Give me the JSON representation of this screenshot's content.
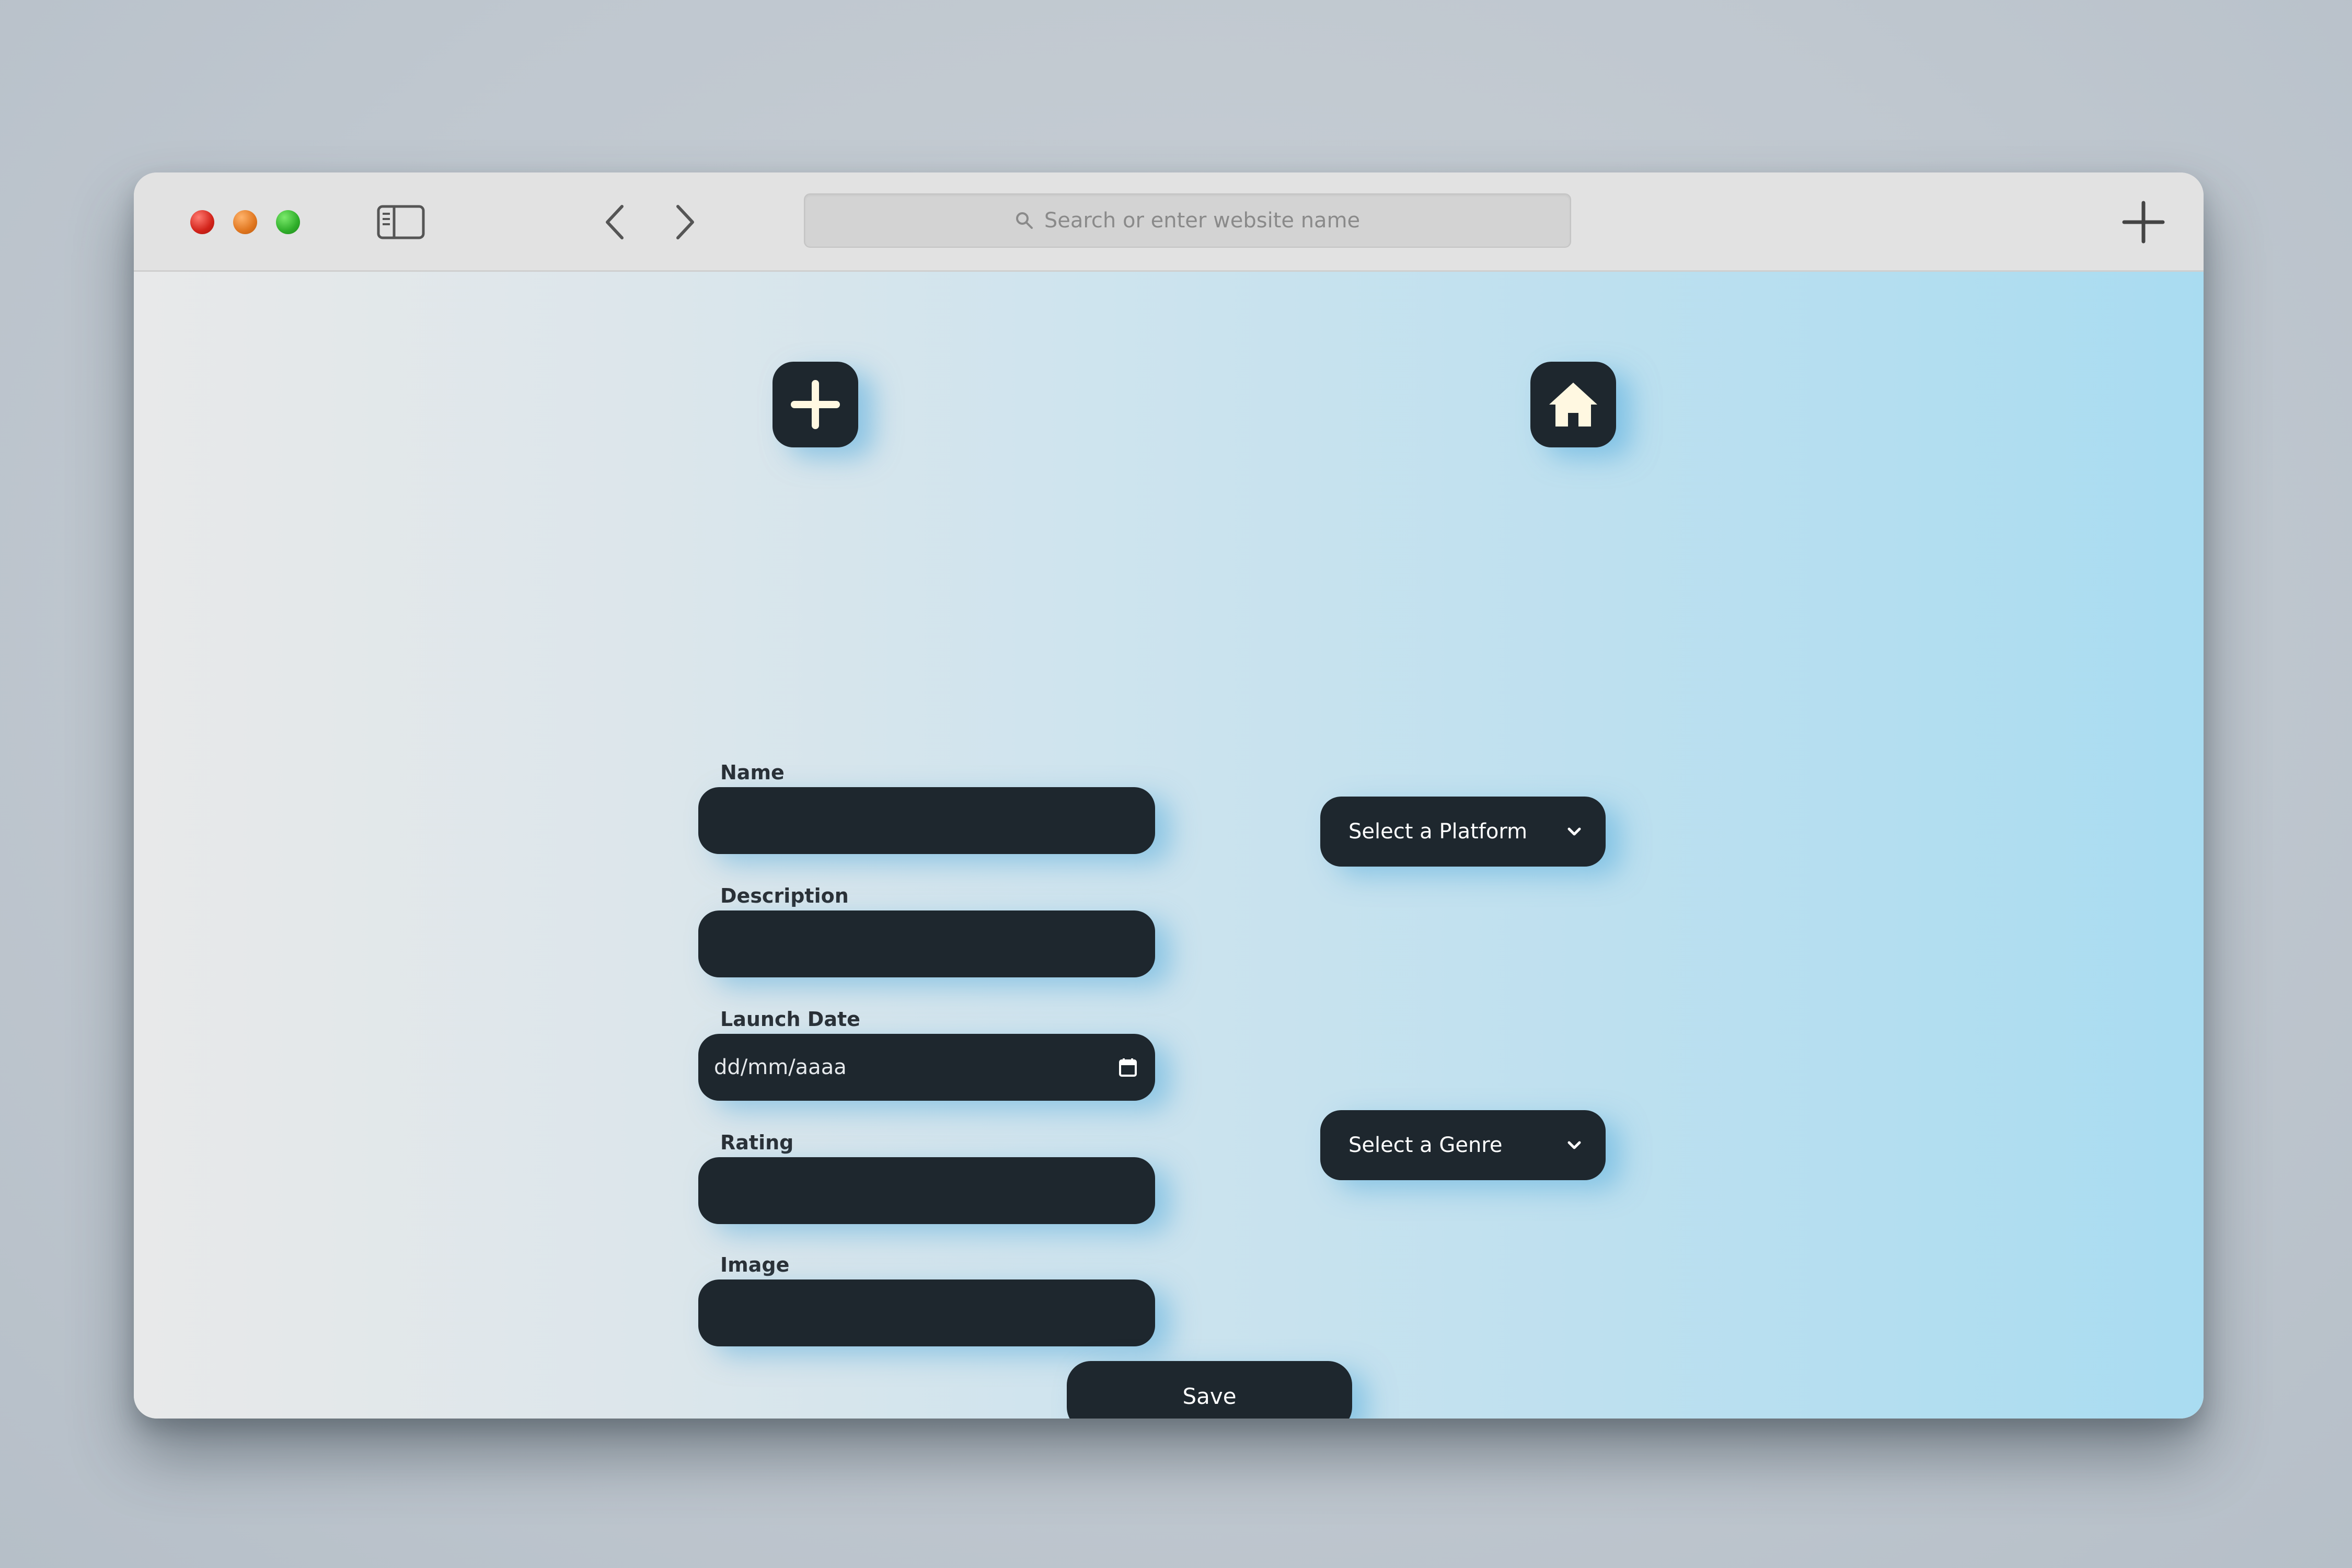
{
  "browser": {
    "address_placeholder": "Search or enter website name"
  },
  "icons": {
    "add": "plus-icon",
    "home": "home-icon",
    "calendar": "calendar-icon",
    "chevron": "chevron-down-icon"
  },
  "form": {
    "name_label": "Name",
    "description_label": "Description",
    "launch_date_label": "Launch Date",
    "launch_date_placeholder": "dd/mm/aaaa",
    "rating_label": "Rating",
    "image_label": "Image",
    "platform_select": "Select a Platform",
    "genre_select": "Select a Genre",
    "save_label": "Save"
  },
  "colors": {
    "control_bg": "#1e272e",
    "glow": "#50aadc",
    "icon_fill": "#fff8e1"
  }
}
